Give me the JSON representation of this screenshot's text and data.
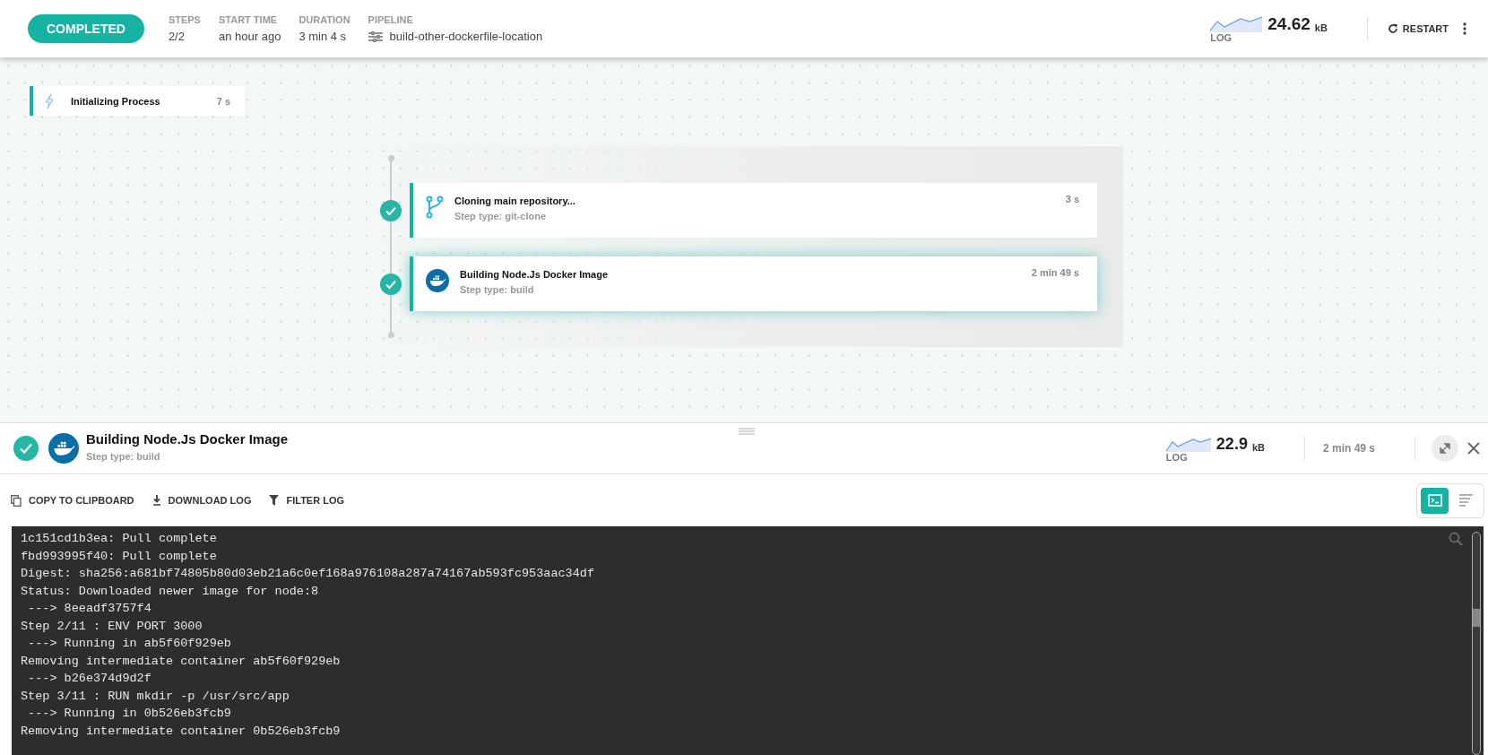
{
  "header": {
    "status": "COMPLETED",
    "stats": [
      {
        "label": "STEPS",
        "value": "2/2"
      },
      {
        "label": "START TIME",
        "value": "an hour ago"
      },
      {
        "label": "DURATION",
        "value": "3 min 4 s"
      }
    ],
    "pipeline": {
      "label": "PIPELINE",
      "value": "build-other-dockerfile-location"
    },
    "log": {
      "label": "LOG",
      "size": "24.62",
      "unit": "kB"
    },
    "restart": "RESTART"
  },
  "init_step": {
    "name": "Initializing Process",
    "duration": "7 s"
  },
  "steps": [
    {
      "kind": "git",
      "name": "Cloning main repository...",
      "type": "Step type: git-clone",
      "duration": "3 s",
      "done": true,
      "selected": false
    },
    {
      "kind": "docker",
      "name": "Building Node.Js Docker Image",
      "type": "Step type: build",
      "duration": "2 min 49 s",
      "done": true,
      "selected": true
    }
  ],
  "detail": {
    "kind": "docker",
    "done": true,
    "name": "Building Node.Js Docker Image",
    "type": "Step type: build",
    "log": {
      "label": "LOG",
      "size": "22.9",
      "unit": "kB"
    },
    "duration": "2 min 49 s"
  },
  "toolbar": [
    {
      "kind": "copy",
      "label": "COPY TO CLIPBOARD"
    },
    {
      "kind": "download",
      "label": "DOWNLOAD LOG"
    },
    {
      "kind": "filter",
      "label": "FILTER LOG"
    }
  ],
  "view_modes": [
    {
      "kind": "terminal",
      "selected": true
    },
    {
      "kind": "list",
      "selected": false
    }
  ],
  "log_lines": [
    "1c151cd1b3ea: Pull complete",
    "fbd993995f40: Pull complete",
    "Digest: sha256:a681bf74805b80d03eb21a6c0ef168a976108a287a74167ab593fc953aac34df",
    "Status: Downloaded newer image for node:8",
    " ---> 8eeadf3757f4",
    "Step 2/11 : ENV PORT 3000",
    " ---> Running in ab5f60f929eb",
    "Removing intermediate container ab5f60f929eb",
    " ---> b26e374d9d2f",
    "Step 3/11 : RUN mkdir -p /usr/src/app",
    " ---> Running in 0b526eb3fcb9",
    "Removing intermediate container 0b526eb3fcb9"
  ]
}
